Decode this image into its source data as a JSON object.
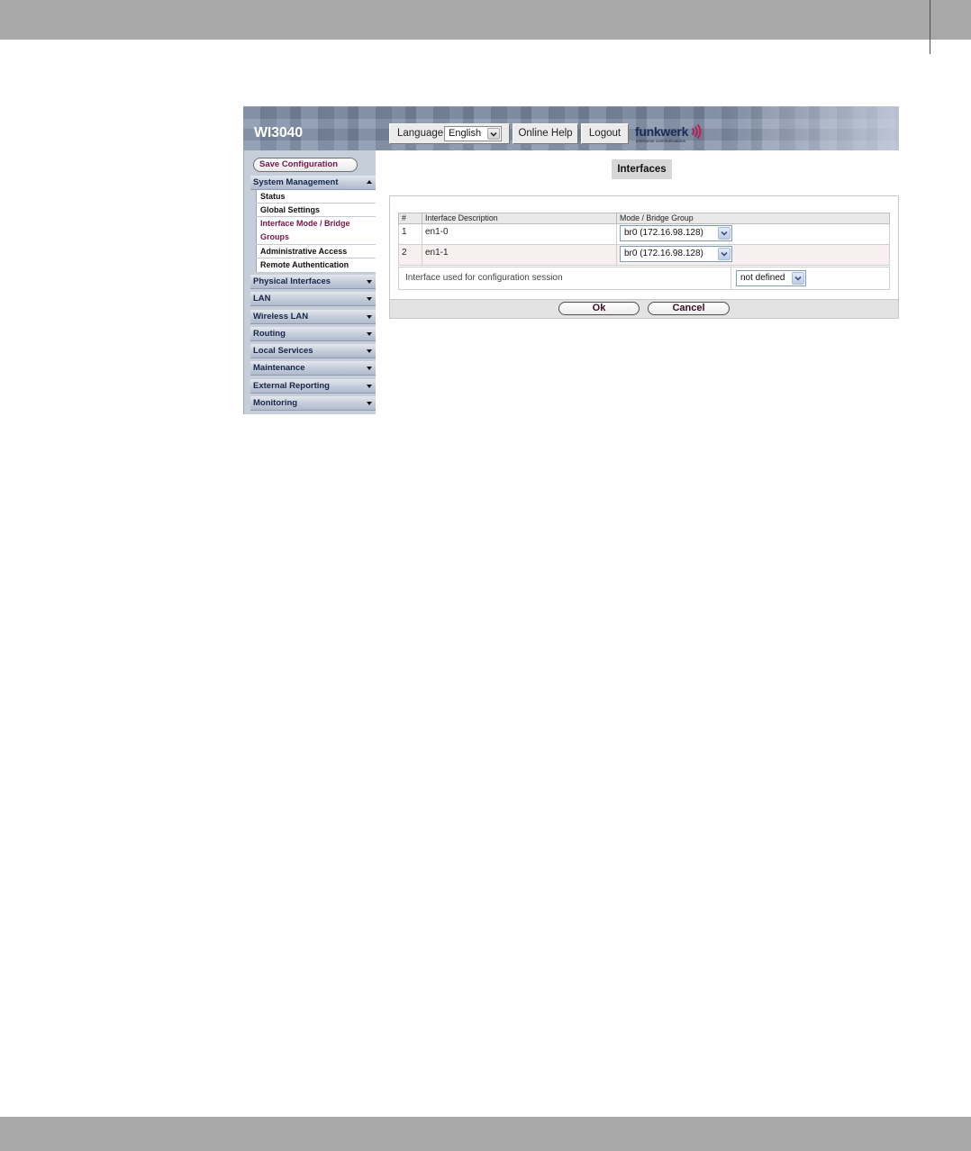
{
  "app": {
    "title": "WI3040"
  },
  "colors": {
    "accent": "#761549",
    "header_bg": "#7f8ea7",
    "sidebar_bg": "#c6ced9",
    "nav_text": "#15264b",
    "logo_waves": "#c4184f",
    "frame_gray": "#a8a8a8"
  },
  "header": {
    "language": {
      "label": "Language",
      "value": "English",
      "icon": "dropdown-arrow-icon"
    },
    "online_help_label": "Online Help",
    "logout_label": "Logout",
    "logo": {
      "wordmark": "funkwerk",
      "tagline": "enterprise communications",
      "icon": "radio-waves-icon"
    }
  },
  "sidebar": {
    "save_config_label": "Save Configuration",
    "expanded_section": {
      "label": "System Management",
      "icon": "triangle-up-icon",
      "items": [
        {
          "label": "Status",
          "active": false
        },
        {
          "label": "Global Settings",
          "active": false
        },
        {
          "label": "Interface Mode / Bridge Groups",
          "active": true
        },
        {
          "label": "Administrative Access",
          "active": false
        },
        {
          "label": "Remote Authentication",
          "active": false
        }
      ]
    },
    "sections": [
      {
        "label": "Physical Interfaces",
        "icon": "triangle-down-icon"
      },
      {
        "label": "LAN",
        "icon": "triangle-down-icon"
      },
      {
        "label": "Wireless LAN",
        "icon": "triangle-down-icon"
      },
      {
        "label": "Routing",
        "icon": "triangle-down-icon"
      },
      {
        "label": "Local Services",
        "icon": "triangle-down-icon"
      },
      {
        "label": "Maintenance",
        "icon": "triangle-down-icon"
      },
      {
        "label": "External Reporting",
        "icon": "triangle-down-icon"
      },
      {
        "label": "Monitoring",
        "icon": "triangle-down-icon"
      }
    ]
  },
  "main": {
    "page_title": "Interfaces",
    "table": {
      "headers": [
        "#",
        "Interface Description",
        "Mode / Bridge Group"
      ],
      "rows": [
        {
          "number": "1",
          "description": "en1-0",
          "mode": "br0 (172.16.98.128)"
        },
        {
          "number": "2",
          "description": "en1-1",
          "mode": "br0 (172.16.98.128)"
        }
      ]
    },
    "config_session": {
      "label": "Interface used for configuration session",
      "value": "not defined"
    },
    "buttons": {
      "ok": "Ok",
      "cancel": "Cancel"
    }
  }
}
